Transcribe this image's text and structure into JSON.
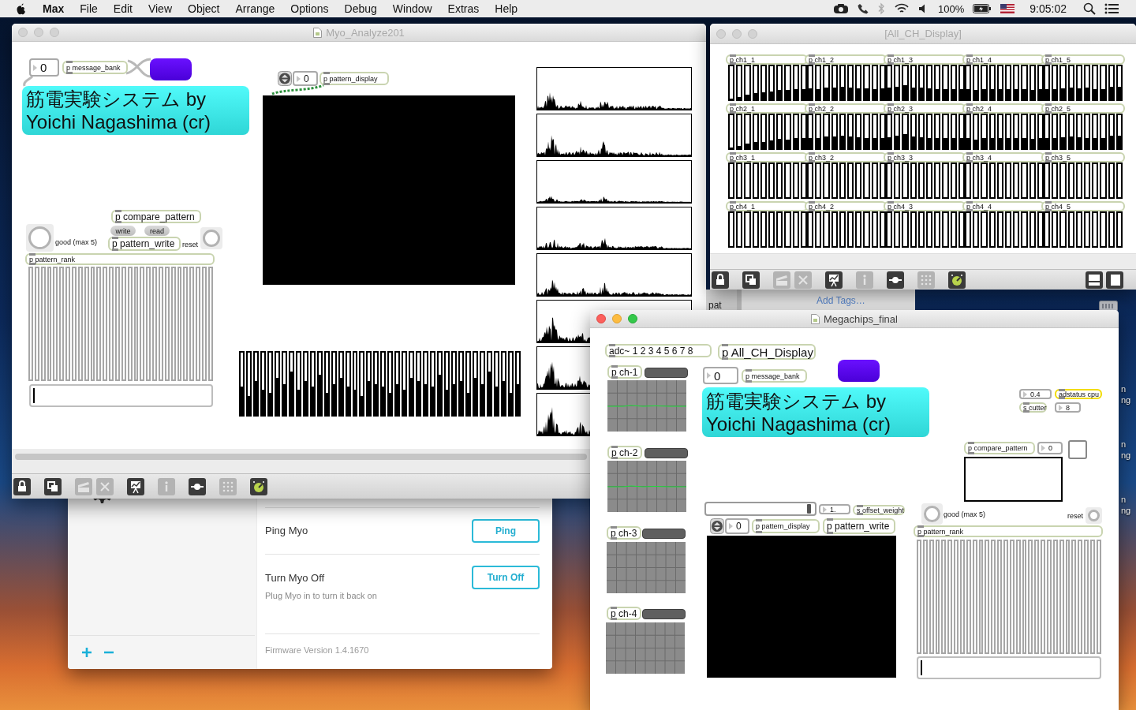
{
  "menu_bar": {
    "app_name": "Max",
    "menus": [
      "File",
      "Edit",
      "View",
      "Object",
      "Arrange",
      "Options",
      "Debug",
      "Window",
      "Extras",
      "Help"
    ],
    "battery_text": "100%",
    "clock": "9:05:02"
  },
  "desktop": {
    "icon_labels": [
      {
        "lines": [
          "n",
          "ng"
        ]
      },
      {
        "lines": [
          "n",
          "ng"
        ]
      },
      {
        "lines": [
          "n",
          "ng"
        ]
      }
    ]
  },
  "finder_window": {
    "sidebar_item": "pat",
    "add_tags": "Add Tags…"
  },
  "myo_connect": {
    "rows": [
      {
        "title": "Ping Myo",
        "button": "Ping"
      },
      {
        "title": "Turn Myo Off",
        "note": "Plug Myo in to turn it back on",
        "button": "Turn Off"
      }
    ],
    "firmware": "Firmware Version 1.4.1670"
  },
  "analyze_window": {
    "title": "Myo_Analyze201",
    "active": false,
    "objects": [
      {
        "kind": "number",
        "text": "0"
      },
      {
        "kind": "object",
        "text": "p message_bank"
      },
      {
        "kind": "swatch"
      },
      {
        "kind": "title_panel",
        "lines": [
          "筋電実験システム by",
          "Yoichi Nagashima (cr)"
        ]
      },
      {
        "kind": "spin_number",
        "text": "0"
      },
      {
        "kind": "object",
        "text": "p pattern_display"
      },
      {
        "kind": "display"
      },
      {
        "kind": "object",
        "text": "p compare_pattern"
      },
      {
        "kind": "message",
        "text": "write"
      },
      {
        "kind": "message",
        "text": "read"
      },
      {
        "kind": "bang"
      },
      {
        "kind": "comment",
        "text": "good (max 5)"
      },
      {
        "kind": "object",
        "text": "p pattern_write"
      },
      {
        "kind": "comment",
        "text": "reset"
      },
      {
        "kind": "bang"
      },
      {
        "kind": "object",
        "text": "p pattern_rank"
      },
      {
        "kind": "multislider",
        "sliders": [
          {
            "level": 0
          },
          {
            "level": 0
          },
          {
            "level": 0
          },
          {
            "level": 0
          },
          {
            "level": 0
          },
          {
            "level": 0
          },
          {
            "level": 0
          },
          {
            "level": 0
          },
          {
            "level": 0
          },
          {
            "level": 0
          },
          {
            "level": 0
          },
          {
            "level": 0
          },
          {
            "level": 0
          },
          {
            "level": 0
          },
          {
            "level": 0
          },
          {
            "level": 0
          },
          {
            "level": 0
          },
          {
            "level": 0
          },
          {
            "level": 0
          },
          {
            "level": 0
          },
          {
            "level": 0
          },
          {
            "level": 0
          },
          {
            "level": 0
          },
          {
            "level": 0
          },
          {
            "level": 0
          },
          {
            "level": 0
          },
          {
            "level": 0
          },
          {
            "level": 0
          },
          {
            "level": 0
          },
          {
            "level": 0
          }
        ]
      },
      {
        "kind": "textfield"
      },
      {
        "kind": "multislider",
        "sliders": [
          {
            "level": 0.45
          },
          {
            "level": 0.3
          },
          {
            "level": 0.55
          },
          {
            "level": 0.4
          },
          {
            "level": 0.35
          },
          {
            "level": 0.6
          },
          {
            "level": 0.5
          },
          {
            "level": 0.7
          },
          {
            "level": 0.4
          },
          {
            "level": 0.55
          },
          {
            "level": 0.45
          },
          {
            "level": 0.65
          },
          {
            "level": 0.35
          },
          {
            "level": 0.5
          },
          {
            "level": 0.6
          },
          {
            "level": 0.45
          },
          {
            "level": 0.4
          },
          {
            "level": 0.3
          },
          {
            "level": 0.55
          },
          {
            "level": 0.5
          },
          {
            "level": 0.45
          },
          {
            "level": 0.35
          },
          {
            "level": 0.5
          },
          {
            "level": 0.4
          },
          {
            "level": 0.6
          },
          {
            "level": 0.55
          },
          {
            "level": 0.5
          },
          {
            "level": 0.45
          },
          {
            "level": 0.65
          },
          {
            "level": 0.4
          },
          {
            "level": 0.5
          },
          {
            "level": 0.55
          },
          {
            "level": 0.35
          },
          {
            "level": 0.6
          },
          {
            "level": 0.5
          },
          {
            "level": 0.7
          },
          {
            "level": 0.45
          },
          {
            "level": 0.55
          },
          {
            "level": 0.35
          },
          {
            "level": 0.5
          }
        ]
      },
      {
        "kind": "spectrum"
      },
      {
        "kind": "spectrum"
      },
      {
        "kind": "spectrum"
      },
      {
        "kind": "spectrum"
      },
      {
        "kind": "spectrum"
      },
      {
        "kind": "spectrum"
      },
      {
        "kind": "spectrum"
      },
      {
        "kind": "spectrum"
      }
    ],
    "toolbar": [
      {
        "disabled": false
      },
      {
        "disabled": false
      },
      {
        "disabled": true
      },
      {
        "disabled": true
      },
      {
        "disabled": false
      },
      {
        "disabled": true
      },
      {
        "disabled": false
      },
      {
        "disabled": true
      },
      {
        "disabled": false
      }
    ]
  },
  "all_ch_window": {
    "title": "[All_CH_Display]",
    "active": false,
    "patchers": [
      {
        "text": "p ch1_1",
        "sliders": [
          {
            "level": 0.02
          },
          {
            "level": 0.07
          },
          {
            "level": 0.15
          },
          {
            "level": 0.2
          },
          {
            "level": 0.22
          },
          {
            "level": 0.25
          },
          {
            "level": 0.28
          },
          {
            "level": 0.28
          },
          {
            "level": 0.3
          },
          {
            "level": 0.32
          }
        ]
      },
      {
        "text": "p ch1_2",
        "sliders": [
          {
            "level": 0.33
          },
          {
            "level": 0.32
          },
          {
            "level": 0.35
          },
          {
            "level": 0.36
          },
          {
            "level": 0.38
          },
          {
            "level": 0.36
          },
          {
            "level": 0.34
          },
          {
            "level": 0.33
          },
          {
            "level": 0.32
          },
          {
            "level": 0.33
          }
        ]
      },
      {
        "text": "p ch1_3",
        "sliders": [
          {
            "level": 0.35
          },
          {
            "level": 0.38
          },
          {
            "level": 0.42
          },
          {
            "level": 0.36
          },
          {
            "level": 0.35
          },
          {
            "level": 0.33
          },
          {
            "level": 0.32
          },
          {
            "level": 0.3
          },
          {
            "level": 0.3
          },
          {
            "level": 0.3
          }
        ]
      },
      {
        "text": "p ch1_4",
        "sliders": [
          {
            "level": 0.3
          },
          {
            "level": 0.28
          },
          {
            "level": 0.3
          },
          {
            "level": 0.32
          },
          {
            "level": 0.3
          },
          {
            "level": 0.3
          },
          {
            "level": 0.32
          },
          {
            "level": 0.3
          },
          {
            "level": 0.28
          },
          {
            "level": 0.3
          }
        ]
      },
      {
        "text": "p ch1_5",
        "sliders": [
          {
            "level": 0.3
          },
          {
            "level": 0.32
          },
          {
            "level": 0.33
          },
          {
            "level": 0.35
          },
          {
            "level": 0.33
          },
          {
            "level": 0.35
          },
          {
            "level": 0.32
          },
          {
            "level": 0.3
          },
          {
            "level": 0.38
          },
          {
            "level": 0.38
          }
        ]
      },
      {
        "text": "p ch2_1",
        "sliders": [
          {
            "level": 0.02
          },
          {
            "level": 0.06
          },
          {
            "level": 0.14
          },
          {
            "level": 0.18
          },
          {
            "level": 0.2
          },
          {
            "level": 0.23
          },
          {
            "level": 0.28
          },
          {
            "level": 0.26
          },
          {
            "level": 0.3
          },
          {
            "level": 0.3
          }
        ]
      },
      {
        "text": "p ch2_2",
        "sliders": [
          {
            "level": 0.32
          },
          {
            "level": 0.3
          },
          {
            "level": 0.35
          },
          {
            "level": 0.35
          },
          {
            "level": 0.38
          },
          {
            "level": 0.35
          },
          {
            "level": 0.33
          },
          {
            "level": 0.32
          },
          {
            "level": 0.3
          },
          {
            "level": 0.32
          }
        ]
      },
      {
        "text": "p ch2_3",
        "sliders": [
          {
            "level": 0.33
          },
          {
            "level": 0.38
          },
          {
            "level": 0.42
          },
          {
            "level": 0.36
          },
          {
            "level": 0.33
          },
          {
            "level": 0.32
          },
          {
            "level": 0.3
          },
          {
            "level": 0.3
          },
          {
            "level": 0.3
          },
          {
            "level": 0.3
          }
        ]
      },
      {
        "text": "p ch2_4",
        "sliders": [
          {
            "level": 0.3
          },
          {
            "level": 0.26
          },
          {
            "level": 0.3
          },
          {
            "level": 0.32
          },
          {
            "level": 0.3
          },
          {
            "level": 0.3
          },
          {
            "level": 0.32
          },
          {
            "level": 0.3
          },
          {
            "level": 0.28
          },
          {
            "level": 0.3
          }
        ]
      },
      {
        "text": "p ch2_5",
        "sliders": [
          {
            "level": 0.3
          },
          {
            "level": 0.32
          },
          {
            "level": 0.33
          },
          {
            "level": 0.35
          },
          {
            "level": 0.33
          },
          {
            "level": 0.32
          },
          {
            "level": 0.3
          },
          {
            "level": 0.3
          },
          {
            "level": 0.38
          },
          {
            "level": 0.38
          }
        ]
      },
      {
        "text": "p ch3_1",
        "sliders": [
          {
            "level": 0
          },
          {
            "level": 0
          },
          {
            "level": 0
          },
          {
            "level": 0
          },
          {
            "level": 0
          },
          {
            "level": 0
          },
          {
            "level": 0
          },
          {
            "level": 0
          },
          {
            "level": 0
          },
          {
            "level": 0
          }
        ]
      },
      {
        "text": "p ch3_2",
        "sliders": [
          {
            "level": 0
          },
          {
            "level": 0
          },
          {
            "level": 0
          },
          {
            "level": 0
          },
          {
            "level": 0
          },
          {
            "level": 0
          },
          {
            "level": 0
          },
          {
            "level": 0
          },
          {
            "level": 0
          },
          {
            "level": 0
          }
        ]
      },
      {
        "text": "p ch3_3",
        "sliders": [
          {
            "level": 0
          },
          {
            "level": 0
          },
          {
            "level": 0
          },
          {
            "level": 0
          },
          {
            "level": 0
          },
          {
            "level": 0
          },
          {
            "level": 0
          },
          {
            "level": 0
          },
          {
            "level": 0
          },
          {
            "level": 0
          }
        ]
      },
      {
        "text": "p ch3_4",
        "sliders": [
          {
            "level": 0
          },
          {
            "level": 0
          },
          {
            "level": 0
          },
          {
            "level": 0
          },
          {
            "level": 0
          },
          {
            "level": 0
          },
          {
            "level": 0
          },
          {
            "level": 0
          },
          {
            "level": 0
          },
          {
            "level": 0
          }
        ]
      },
      {
        "text": "p ch3_5",
        "sliders": [
          {
            "level": 0
          },
          {
            "level": 0
          },
          {
            "level": 0
          },
          {
            "level": 0
          },
          {
            "level": 0
          },
          {
            "level": 0
          },
          {
            "level": 0
          },
          {
            "level": 0
          },
          {
            "level": 0
          },
          {
            "level": 0
          }
        ]
      },
      {
        "text": "p ch4_1",
        "sliders": [
          {
            "level": 0
          },
          {
            "level": 0
          },
          {
            "level": 0
          },
          {
            "level": 0
          },
          {
            "level": 0
          },
          {
            "level": 0
          },
          {
            "level": 0
          },
          {
            "level": 0
          },
          {
            "level": 0
          },
          {
            "level": 0
          }
        ]
      },
      {
        "text": "p ch4_2",
        "sliders": [
          {
            "level": 0
          },
          {
            "level": 0
          },
          {
            "level": 0
          },
          {
            "level": 0
          },
          {
            "level": 0
          },
          {
            "level": 0
          },
          {
            "level": 0
          },
          {
            "level": 0
          },
          {
            "level": 0
          },
          {
            "level": 0
          }
        ]
      },
      {
        "text": "p ch4_3",
        "sliders": [
          {
            "level": 0
          },
          {
            "level": 0
          },
          {
            "level": 0
          },
          {
            "level": 0
          },
          {
            "level": 0
          },
          {
            "level": 0
          },
          {
            "level": 0
          },
          {
            "level": 0
          },
          {
            "level": 0
          },
          {
            "level": 0
          }
        ]
      },
      {
        "text": "p ch4_4",
        "sliders": [
          {
            "level": 0
          },
          {
            "level": 0
          },
          {
            "level": 0
          },
          {
            "level": 0
          },
          {
            "level": 0
          },
          {
            "level": 0
          },
          {
            "level": 0
          },
          {
            "level": 0
          },
          {
            "level": 0
          },
          {
            "level": 0
          }
        ]
      },
      {
        "text": "p ch4_5",
        "sliders": [
          {
            "level": 0
          },
          {
            "level": 0
          },
          {
            "level": 0
          },
          {
            "level": 0
          },
          {
            "level": 0
          },
          {
            "level": 0
          },
          {
            "level": 0
          },
          {
            "level": 0
          },
          {
            "level": 0
          },
          {
            "level": 0
          }
        ]
      }
    ],
    "toolbar": [
      {
        "disabled": false
      },
      {
        "disabled": false
      },
      {
        "disabled": true
      },
      {
        "disabled": true
      },
      {
        "disabled": false
      },
      {
        "disabled": true
      },
      {
        "disabled": false
      },
      {
        "disabled": true
      },
      {
        "disabled": false
      }
    ]
  },
  "megachips_window": {
    "title": "Megachips_final",
    "active": true,
    "objects": [
      {
        "kind": "object",
        "text": "adc~ 1 2 3 4 5 6 7 8"
      },
      {
        "kind": "object",
        "text": "p All_CH_Display"
      },
      {
        "kind": "object",
        "text": "p ch-1"
      },
      {
        "kind": "meter",
        "level": 0
      },
      {
        "kind": "scope"
      },
      {
        "kind": "object",
        "text": "p ch-2"
      },
      {
        "kind": "meter",
        "level": 0
      },
      {
        "kind": "scope"
      },
      {
        "kind": "object",
        "text": "p ch-3"
      },
      {
        "kind": "meter",
        "level": 0
      },
      {
        "kind": "scope"
      },
      {
        "kind": "object",
        "text": "p ch-4"
      },
      {
        "kind": "meter",
        "level": 0
      },
      {
        "kind": "scope"
      },
      {
        "kind": "number",
        "text": "0"
      },
      {
        "kind": "object",
        "text": "p message_bank"
      },
      {
        "kind": "swatch"
      },
      {
        "kind": "title_panel",
        "lines": [
          "筋電実験システム by",
          "Yoichi Nagashima (cr)"
        ]
      },
      {
        "kind": "slider",
        "level": 0.97
      },
      {
        "kind": "number",
        "text": "1."
      },
      {
        "kind": "object",
        "text": "s offset_weight"
      },
      {
        "kind": "spin_number",
        "text": "0"
      },
      {
        "kind": "object",
        "text": "p pattern_display"
      },
      {
        "kind": "object",
        "text": "p pattern_write"
      },
      {
        "kind": "display"
      },
      {
        "kind": "number",
        "text": "0.4"
      },
      {
        "kind": "status_object",
        "text": "adstatus cpu"
      },
      {
        "kind": "object",
        "text": "s cutter"
      },
      {
        "kind": "number",
        "text": "8"
      },
      {
        "kind": "object",
        "text": "p compare_pattern"
      },
      {
        "kind": "number",
        "text": "0"
      },
      {
        "kind": "toggle",
        "checked": false
      },
      {
        "kind": "lcd"
      },
      {
        "kind": "bang"
      },
      {
        "kind": "comment",
        "text": "good (max 5)"
      },
      {
        "kind": "comment",
        "text": "reset"
      },
      {
        "kind": "bang"
      },
      {
        "kind": "object",
        "text": "p pattern_rank"
      },
      {
        "kind": "multislider",
        "sliders": [
          {
            "level": 0
          },
          {
            "level": 0
          },
          {
            "level": 0
          },
          {
            "level": 0
          },
          {
            "level": 0
          },
          {
            "level": 0
          },
          {
            "level": 0
          },
          {
            "level": 0
          },
          {
            "level": 0
          },
          {
            "level": 0
          },
          {
            "level": 0
          },
          {
            "level": 0
          },
          {
            "level": 0
          },
          {
            "level": 0
          },
          {
            "level": 0
          },
          {
            "level": 0
          },
          {
            "level": 0
          },
          {
            "level": 0
          },
          {
            "level": 0
          },
          {
            "level": 0
          },
          {
            "level": 0
          },
          {
            "level": 0
          },
          {
            "level": 0
          },
          {
            "level": 0
          },
          {
            "level": 0
          },
          {
            "level": 0
          },
          {
            "level": 0
          },
          {
            "level": 0
          },
          {
            "level": 0
          },
          {
            "level": 0
          }
        ]
      },
      {
        "kind": "textfield"
      }
    ]
  }
}
